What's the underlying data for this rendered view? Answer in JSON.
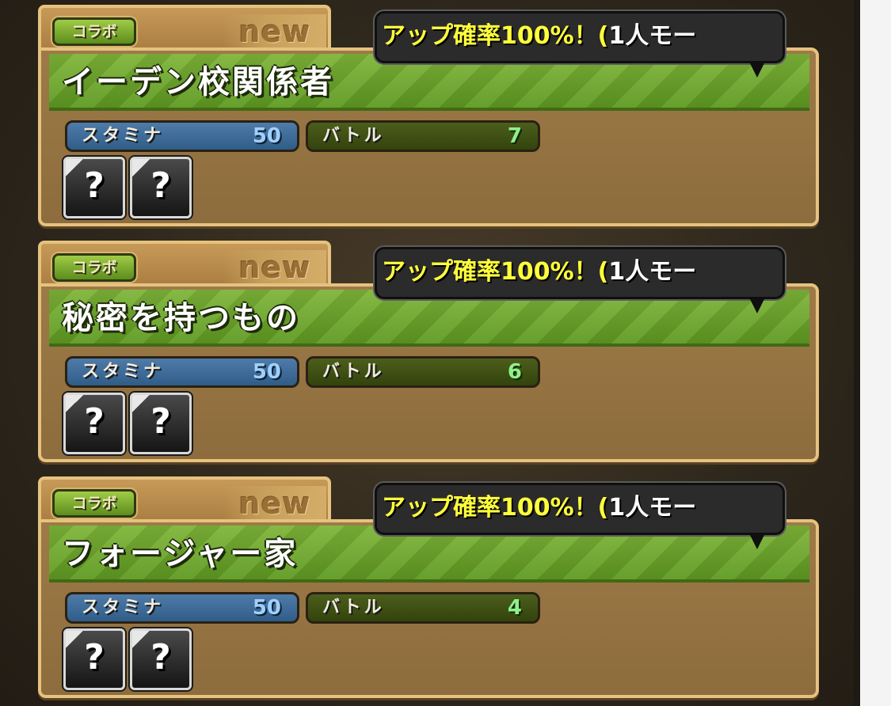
{
  "collab_label": "コラボ",
  "new_label": "new",
  "drop_banner": {
    "prefix": "アップ確率100%！(",
    "suffix": "1人モー"
  },
  "stamina_label": "スタミナ",
  "battle_label": "バトル",
  "unknown_reward": "?",
  "dungeons": [
    {
      "name": "イーデン校関係者",
      "stamina": "50",
      "battles": "7"
    },
    {
      "name": "秘密を持つもの",
      "stamina": "50",
      "battles": "6"
    },
    {
      "name": "フォージャー家",
      "stamina": "50",
      "battles": "4"
    }
  ],
  "colors": {
    "title_green": "#6fa82c",
    "card_brown": "#9a7744",
    "banner_yellow": "#ffff3c",
    "stamina_blue": "#3d6b98",
    "battle_olive": "#3f5014"
  }
}
